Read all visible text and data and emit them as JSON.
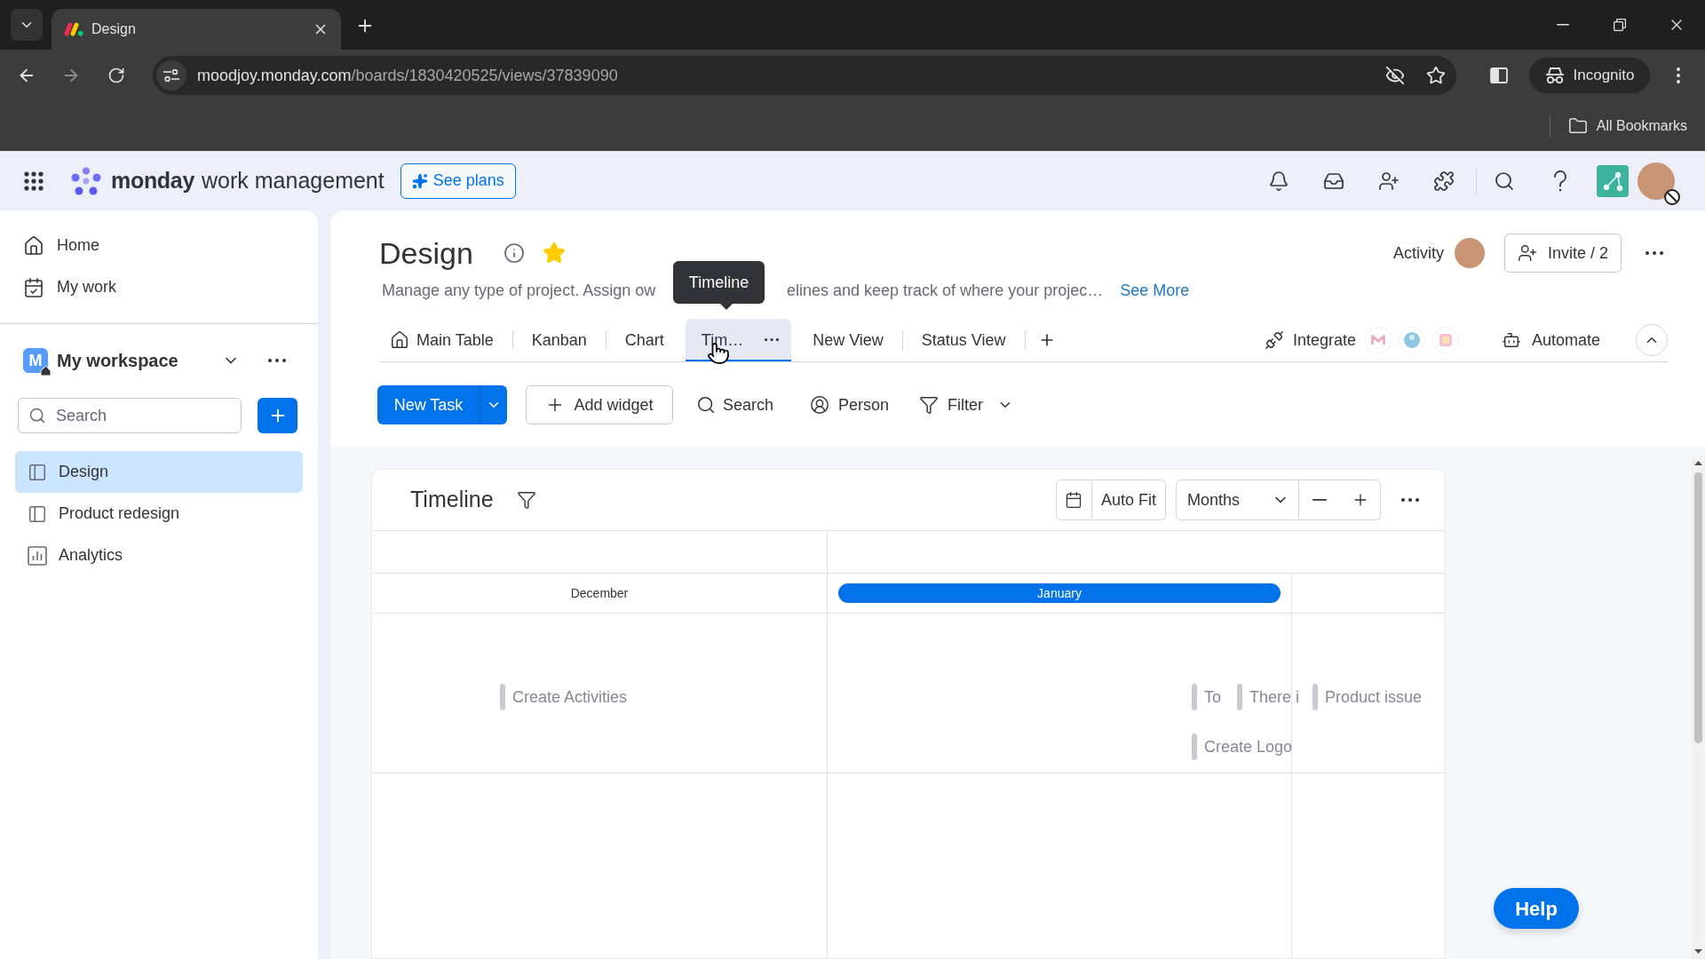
{
  "browser": {
    "tabs": [
      {
        "title": "Design",
        "selected": true
      }
    ],
    "url": {
      "host": "moodjoy.monday.com",
      "path": "/boards/1830420525/views/37839090"
    },
    "profile": "Incognito",
    "bookmarks": "All Bookmarks"
  },
  "app_header": {
    "brand": "monday",
    "product": "work management",
    "plans_button": "See plans"
  },
  "sidebar": {
    "nav": [
      {
        "label": "Home",
        "kind": "home"
      },
      {
        "label": "My work",
        "kind": "work"
      }
    ],
    "workspace": {
      "initial": "M",
      "name": "My workspace"
    },
    "search": {
      "placeholder": "Search"
    },
    "boards": [
      {
        "label": "Design",
        "kind": "board",
        "selected": true
      },
      {
        "label": "Product redesign",
        "kind": "board",
        "selected": false
      },
      {
        "label": "Analytics",
        "kind": "dashboard",
        "selected": false
      }
    ]
  },
  "board": {
    "title": "Design",
    "starred": true,
    "description": [
      "Manage any type of project. Assign ow",
      "elines and keep track of where your projec…"
    ],
    "see_more": "See More",
    "activity": "Activity",
    "invite": "Invite / 2",
    "views": [
      {
        "label": "Main Table",
        "kind": "home",
        "selected": false
      },
      {
        "label": "Kanban",
        "kind": "view",
        "selected": false
      },
      {
        "label": "Chart",
        "kind": "view",
        "selected": false
      },
      {
        "label": "Tim…",
        "kind": "view",
        "selected": true,
        "tooltip": "Timeline"
      },
      {
        "label": "New View",
        "kind": "view",
        "selected": false
      },
      {
        "label": "Status View",
        "kind": "view",
        "selected": false
      }
    ],
    "integrate": "Integrate",
    "automate": "Automate"
  },
  "toolbar": {
    "new_task": "New Task",
    "add_widget": "Add widget",
    "search": "Search",
    "person": "Person",
    "filter": "Filter"
  },
  "widget": {
    "title": "Timeline",
    "auto_fit": "Auto Fit",
    "scale": "Months",
    "months": [
      {
        "label": "December",
        "current": false
      },
      {
        "label": "January",
        "current": true
      }
    ],
    "lanes": [
      {
        "items": [
          {
            "label": "Create Activities"
          },
          {
            "label": "To"
          },
          {
            "label": "There i"
          },
          {
            "label": "Product issue"
          }
        ]
      },
      {
        "items": [
          {
            "label": "Create Logo"
          }
        ]
      }
    ]
  },
  "help": "Help"
}
